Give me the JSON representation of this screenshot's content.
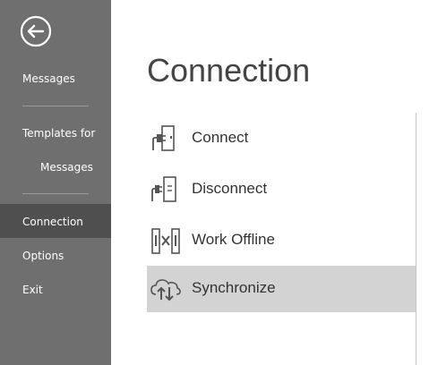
{
  "sidebar": {
    "back_icon": "back-arrow-circle-icon",
    "items": [
      {
        "label": "Messages"
      },
      {
        "label_line1": "Templates for",
        "label_line2": "Messages"
      },
      {
        "label": "Connection",
        "selected": true
      },
      {
        "label": "Options"
      },
      {
        "label": "Exit"
      }
    ],
    "colors": {
      "background": "#6f6f6f",
      "selected_background": "#4f4f4f",
      "text": "#ffffff"
    }
  },
  "main": {
    "title": "Connection",
    "commands": [
      {
        "label": "Connect",
        "icon": "plug-connect-icon"
      },
      {
        "label": "Disconnect",
        "icon": "plug-disconnect-icon"
      },
      {
        "label": "Work Offline",
        "icon": "work-offline-icon"
      },
      {
        "label": "Synchronize",
        "icon": "cloud-sync-icon",
        "highlighted": true
      }
    ],
    "colors": {
      "title": "#444444",
      "highlight": "#d3d3d3"
    }
  }
}
